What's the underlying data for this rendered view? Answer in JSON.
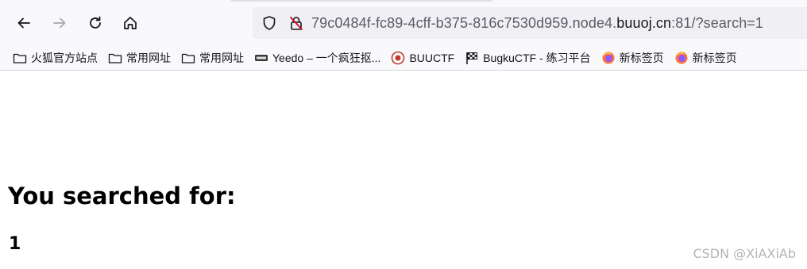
{
  "browser": {
    "url": {
      "prefix": "79c0484f-fc89-4cff-b375-816c7530d959.node4.",
      "host": "buuoj.cn",
      "suffix": ":81/?search=1"
    },
    "nav_icons": [
      "back-arrow-icon",
      "forward-arrow-icon",
      "reload-icon",
      "home-icon"
    ],
    "bookmarks": [
      {
        "label": "火狐官方站点",
        "icon": "folder-icon"
      },
      {
        "label": "常用网址",
        "icon": "folder-icon"
      },
      {
        "label": "常用网址",
        "icon": "folder-icon"
      },
      {
        "label": "Yeedo – 一个疯狂抠...",
        "icon": "yeedo-favicon"
      },
      {
        "label": "BUUCTF",
        "icon": "buuctf-favicon"
      },
      {
        "label": "BugkuCTF - 练习平台",
        "icon": "flag-favicon"
      },
      {
        "label": "新标签页",
        "icon": "firefox-icon"
      },
      {
        "label": "新标签页",
        "icon": "firefox-icon"
      }
    ]
  },
  "page": {
    "heading": "You searched for:",
    "result": "1"
  },
  "watermark": "CSDN @XiAXiAb",
  "colors": {
    "toolbar_bg": "#f9f9fb",
    "urlbar_bg": "#f0f0f4",
    "url_muted": "#5b5b66",
    "text": "#15141a",
    "shield_red": "#d70022"
  }
}
